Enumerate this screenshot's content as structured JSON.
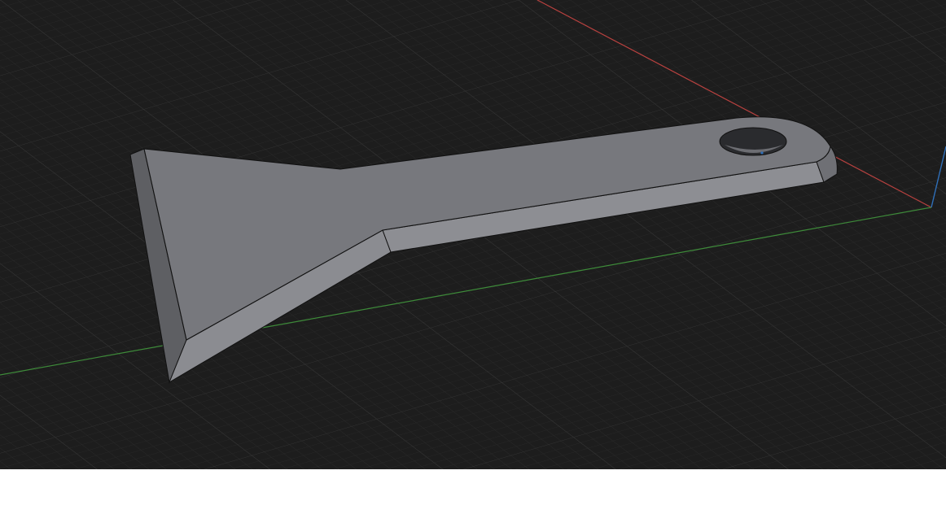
{
  "viewport": {
    "background_color": "#1d1d1d",
    "grid_minor_color": "#2b2b2b",
    "grid_major_color": "#363636",
    "x_axis_color": "#b8413f",
    "y_axis_color": "#3e8b3a",
    "z_axis_color": "#2f6fb8"
  },
  "model": {
    "object": "scraper",
    "top_face_color": "#77787d",
    "bevel_color": "#8b8c91",
    "side_color": "#5e5f63",
    "edge_color": "#111111",
    "hole_interior_color": "#2a2b2e"
  },
  "below_area": {
    "background_color": "#ffffff"
  }
}
